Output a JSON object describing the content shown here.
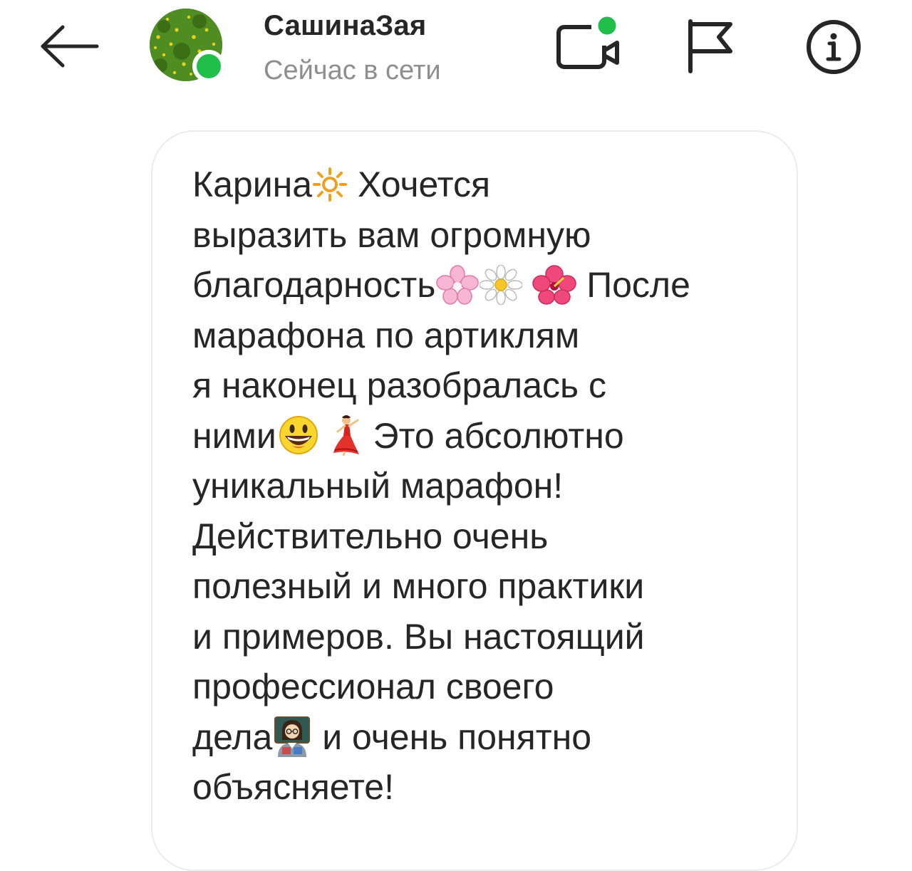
{
  "header": {
    "username": "СашинаЗая",
    "status": "Сейчас в сети",
    "icons": {
      "back": "arrow-left-icon",
      "video": "video-call-icon",
      "flag": "flag-icon",
      "info": "info-icon"
    },
    "colors": {
      "online": "#1fbf4a",
      "status_text": "#8e8e8e",
      "text": "#262626"
    }
  },
  "message": {
    "lines": [
      [
        "Карина",
        " Хочется"
      ],
      [
        "выразить вам огромную"
      ],
      [
        "благодарность",
        " ",
        " После"
      ],
      [
        "марафона по артиклям"
      ],
      [
        "я наконец разобралась с"
      ],
      [
        "ними",
        " ",
        "  Это абсолютно"
      ],
      [
        "уникальный марафон!"
      ],
      [
        "Действительно очень"
      ],
      [
        "полезный и много практики"
      ],
      [
        "и примеров. Вы настоящий"
      ],
      [
        "профессионал своего"
      ],
      [
        "дела",
        " и очень понятно"
      ],
      [
        "объясняете!"
      ]
    ],
    "emojis": {
      "sun": "sun-emoji-icon",
      "cherry_blossom": "cherry-blossom-emoji-icon",
      "daisy": "daisy-emoji-icon",
      "hibiscus": "hibiscus-emoji-icon",
      "smiley": "smiley-emoji-icon",
      "dancer": "dancer-emoji-icon",
      "teacher": "teacher-emoji-icon"
    }
  }
}
